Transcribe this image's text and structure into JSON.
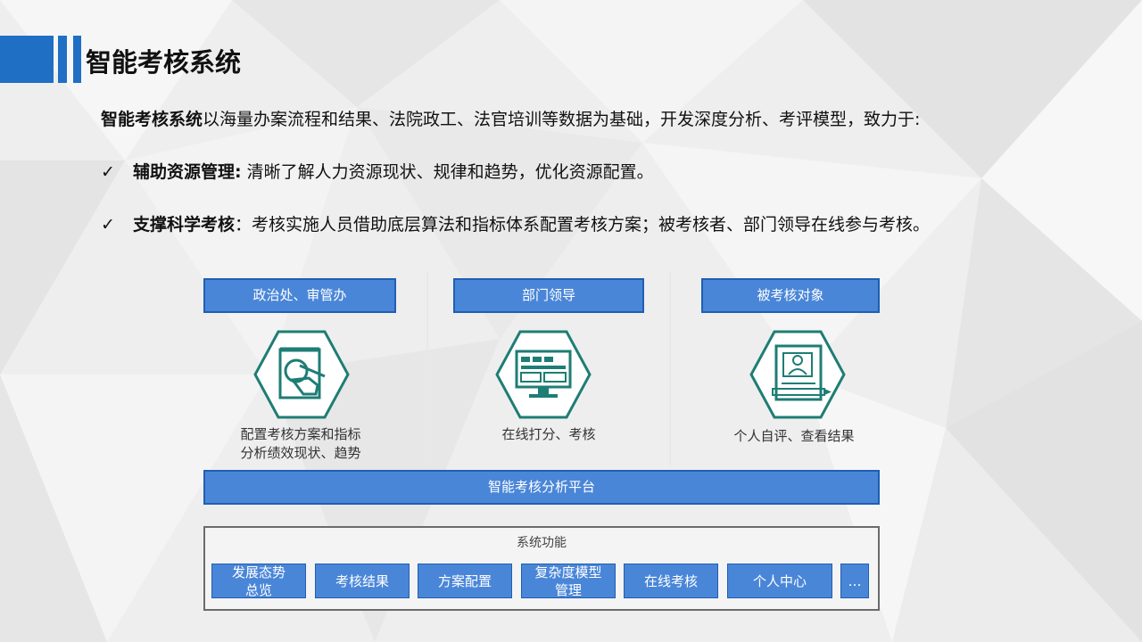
{
  "header": {
    "title": "智能考核系统"
  },
  "intro": {
    "bold": "智能考核系统",
    "text": "以海量办案流程和结果、法院政工、法官培训等数据为基础，开发深度分析、考评模型，致力于:"
  },
  "bullets": [
    {
      "check": "✓",
      "bold": "辅助资源管理:",
      "text": " 清晰了解人力资源现状、规律和趋势，优化资源配置。"
    },
    {
      "check": "✓",
      "bold": "支撑科学考核",
      "text": "：考核实施人员借助底层算法和指标体系配置考核方案；被考核者、部门领导在线参与考核。"
    }
  ],
  "diagram": {
    "roles": [
      {
        "label": "政治处、审管办",
        "icon": "hand-writing-plan-icon",
        "caption_lines": [
          "配置考核方案和指标",
          "分析绩效现状、趋势"
        ]
      },
      {
        "label": "部门领导",
        "icon": "monitor-dashboard-icon",
        "caption_lines": [
          "在线打分、考核"
        ]
      },
      {
        "label": "被考核对象",
        "icon": "profile-document-icon",
        "caption_lines": [
          "个人自评、查看结果"
        ]
      }
    ],
    "platform": "智能考核分析平台",
    "functions_title": "系统功能",
    "functions": [
      {
        "lines": [
          "发展态势",
          "总览"
        ]
      },
      {
        "lines": [
          "考核结果"
        ]
      },
      {
        "lines": [
          "方案配置"
        ]
      },
      {
        "lines": [
          "复杂度模型",
          "管理"
        ]
      },
      {
        "lines": [
          "在线考核"
        ]
      },
      {
        "lines": [
          "个人中心"
        ]
      },
      {
        "lines": [
          "…"
        ]
      }
    ]
  },
  "colors": {
    "accent": "#1f6fc5",
    "box_fill": "#4a86d8",
    "icon": "#1e7d74"
  }
}
